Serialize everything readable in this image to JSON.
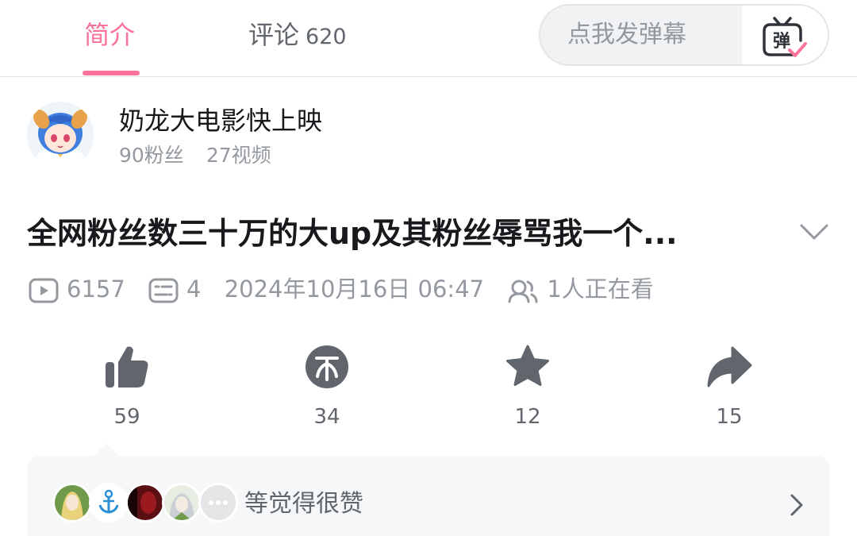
{
  "tabs": {
    "intro_label": "简介",
    "comments_label": "评论",
    "comments_count": "620"
  },
  "danmaku": {
    "placeholder": "点我发弹幕",
    "button_glyph": "弹",
    "button_icon": "danmaku-tv-icon"
  },
  "uploader": {
    "name": "奶龙大电影快上映",
    "followers": "90粉丝",
    "videos": "27视频"
  },
  "video": {
    "title": "全网粉丝数三十万的大up及其粉丝辱骂我一个...",
    "views": "6157",
    "danmaku_count": "4",
    "published": "2024年10月16日 06:47",
    "watching": "1人正在看"
  },
  "actions": {
    "like_count": "59",
    "coin_count": "34",
    "favorite_count": "12",
    "share_count": "15"
  },
  "likers": {
    "text": "等觉得很赞"
  },
  "colors": {
    "accent": "#fb7299",
    "icon_gray": "#61666d",
    "muted_text": "#9499a0"
  }
}
